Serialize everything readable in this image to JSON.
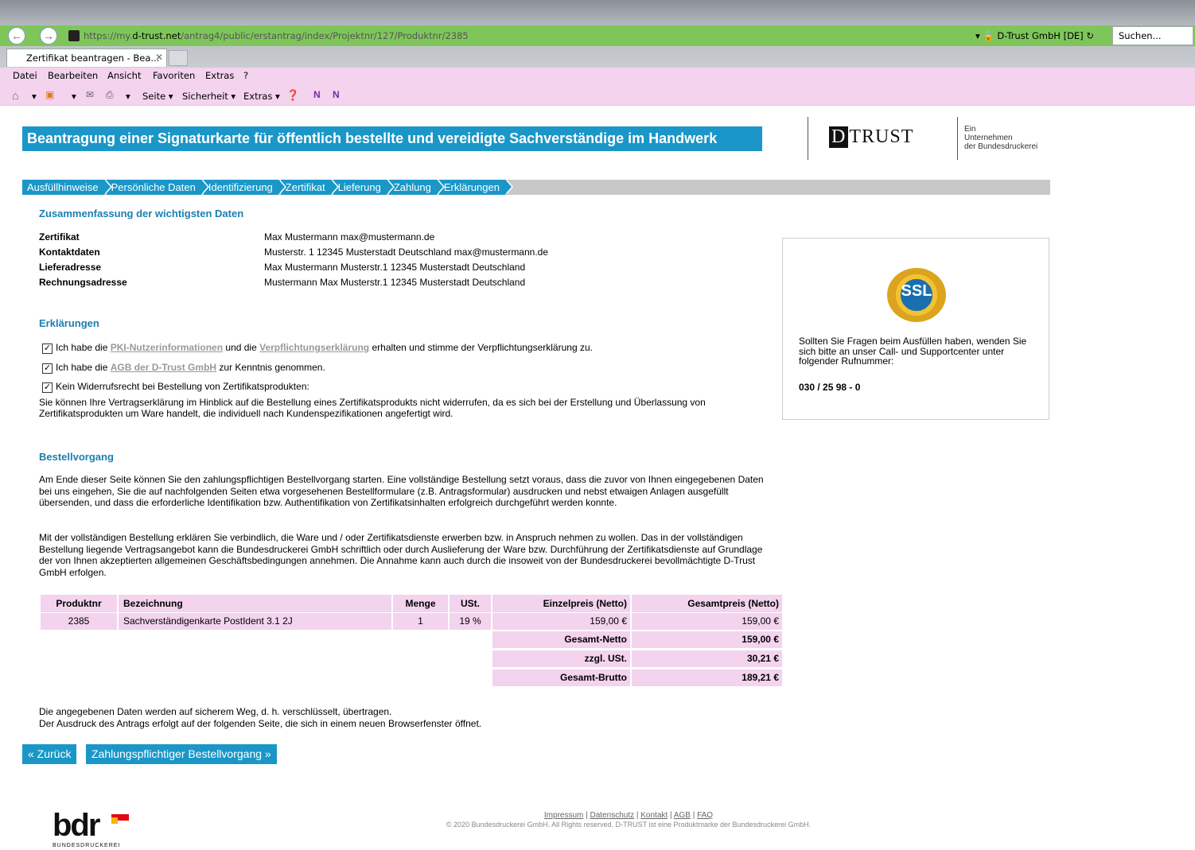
{
  "browser": {
    "url_prefix": "https://my.",
    "url_domain": "d-trust.net",
    "url_path": "/antrag4/public/erstantrag/index/Projektnr/127/Produktnr/2385",
    "site_identity": "D-Trust GmbH [DE]",
    "search_placeholder": "Suchen...",
    "tab_title": "Zertifikat beantragen - Bea...",
    "menu": [
      "Datei",
      "Bearbeiten",
      "Ansicht",
      "Favoriten",
      "Extras",
      "?"
    ],
    "toolbar": [
      "Seite ▾",
      "Sicherheit ▾",
      "Extras ▾"
    ]
  },
  "page": {
    "title": "Beantragung einer Signaturkarte für öffentlich bestellte und vereidigte Sachverständige im Handwerk",
    "logo_text": "TRUST",
    "logo_letter": "D",
    "logo_sub": [
      "Ein",
      "Unternehmen",
      "der Bundesdruckerei"
    ]
  },
  "steps": [
    "Ausfüllhinweise",
    "Persönliche Daten",
    "Identifizierung",
    "Zertifikat",
    "Lieferung",
    "Zahlung",
    "Erklärungen"
  ],
  "summary": {
    "title": "Zusammenfassung der wichtigsten Daten",
    "rows": [
      {
        "label": "Zertifikat",
        "value": "Max Mustermann max@mustermann.de"
      },
      {
        "label": "Kontaktdaten",
        "value": "Musterstr. 1 12345 Musterstadt Deutschland max@mustermann.de"
      },
      {
        "label": "Lieferadresse",
        "value": "Max Mustermann Musterstr.1 12345 Musterstadt Deutschland"
      },
      {
        "label": "Rechnungsadresse",
        "value": "Mustermann Max Musterstr.1 12345 Musterstadt Deutschland"
      }
    ]
  },
  "declarations": {
    "title": "Erklärungen",
    "cb1_pre": "Ich habe die ",
    "cb1_link1": "PKI-Nutzerinformationen",
    "cb1_mid": " und die ",
    "cb1_link2": "Verpflichtungserklärung",
    "cb1_post": " erhalten und stimme der Verpflichtungserklärung zu.",
    "cb2_pre": "Ich habe die ",
    "cb2_link": "AGB der D-Trust GmbH",
    "cb2_post": " zur Kenntnis genommen.",
    "cb3": "Kein Widerrufsrecht bei Bestellung von Zertifikatsprodukten:",
    "cb3_detail": "Sie können Ihre Vertragserklärung im Hinblick auf die Bestellung eines Zertifikatsprodukts nicht widerrufen, da es sich bei der Erstellung und Überlassung von Zertifikatsprodukten um Ware handelt, die individuell nach Kundenspezifikationen angefertigt wird."
  },
  "order": {
    "title": "Bestellvorgang",
    "para1": "Am Ende dieser Seite können Sie den zahlungspflichtigen Bestellvorgang starten. Eine vollständige Bestellung setzt voraus, dass die zuvor von Ihnen eingegebenen Daten bei uns eingehen, Sie die auf nachfolgenden Seiten etwa vorgesehenen Bestellformulare (z.B. Antragsformular) ausdrucken und nebst etwaigen Anlagen ausgefüllt übersenden, und dass die erforderliche Identifikation bzw. Authentifikation von Zertifikatsinhalten erfolgreich durchgeführt werden konnte.",
    "para2": "Mit der vollständigen Bestellung erklären Sie verbindlich, die Ware und / oder Zertifikatsdienste erwerben bzw. in Anspruch nehmen zu wollen. Das in der vollständigen Bestellung liegende Vertragsangebot kann die Bundesdruckerei GmbH schriftlich oder durch Auslieferung der Ware bzw. Durchführung der Zertifikatsdienste auf Grundlage der von Ihnen akzeptierten allgemeinen Geschäftsbedingungen annehmen. Die Annahme kann auch durch die insoweit von der Bundesdruckerei bevollmächtigte D-Trust GmbH erfolgen."
  },
  "table": {
    "headers": [
      "Produktnr",
      "Bezeichnung",
      "Menge",
      "USt.",
      "Einzelpreis (Netto)",
      "Gesamtpreis (Netto)"
    ],
    "row": [
      "2385",
      "Sachverständigenkarte PostIdent 3.1 2J",
      "1",
      "19 %",
      "159,00 €",
      "159,00 €"
    ],
    "totals": [
      {
        "label": "Gesamt-Netto",
        "value": "159,00 €"
      },
      {
        "label": "zzgl. USt.",
        "value": "30,21 €"
      },
      {
        "label": "Gesamt-Brutto",
        "value": "189,21 €"
      }
    ]
  },
  "notes": [
    "Die angegebenen Daten werden auf sicherem Weg, d. h. verschlüsselt, übertragen.",
    "Der Ausdruck des Antrags erfolgt auf der folgenden Seite, die sich in einem neuen Browserfenster öffnet."
  ],
  "buttons": {
    "back": "«  Zurück",
    "order": "Zahlungspflichtiger Bestellvorgang  »"
  },
  "sidebox": {
    "seal": "SSL",
    "text": "Sollten Sie Fragen beim Ausfüllen haben, wenden Sie sich bitte an unser Call- und Supportcenter unter folgender Rufnummer:",
    "phone": "030 / 25 98 - 0"
  },
  "footer": {
    "links": [
      "Impressum",
      "Datenschutz",
      "Kontakt",
      "AGB",
      "FAQ"
    ],
    "copyright": "© 2020 Bundesdruckerei GmbH. All Rights reserved. D-TRUST ist eine Produktmarke der Bundesdruckerei GmbH.",
    "bdr_logo": "bdr",
    "bdr_sub": "BUNDESDRUCKEREI"
  },
  "colors": {
    "accent": "#1a97c8",
    "menu_bg": "#f3d3ee",
    "address_bar": "#7fc65a"
  }
}
